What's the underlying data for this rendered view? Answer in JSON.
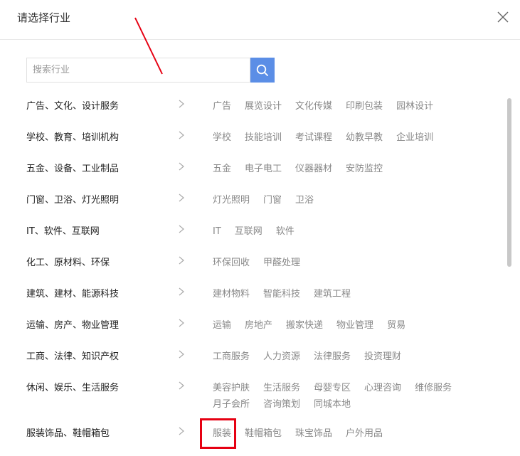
{
  "dialog": {
    "title": "请选择行业"
  },
  "search": {
    "placeholder": "搜索行业",
    "value": ""
  },
  "categories": [
    {
      "name": "广告、文化、设计服务",
      "tags": [
        "广告",
        "展览设计",
        "文化传媒",
        "印刷包装",
        "园林设计"
      ]
    },
    {
      "name": "学校、教育、培训机构",
      "tags": [
        "学校",
        "技能培训",
        "考试课程",
        "幼教早教",
        "企业培训"
      ]
    },
    {
      "name": "五金、设备、工业制品",
      "tags": [
        "五金",
        "电子电工",
        "仪器器材",
        "安防监控"
      ]
    },
    {
      "name": "门窗、卫浴、灯光照明",
      "tags": [
        "灯光照明",
        "门窗",
        "卫浴"
      ]
    },
    {
      "name": "IT、软件、互联网",
      "tags": [
        "IT",
        "互联网",
        "软件"
      ]
    },
    {
      "name": "化工、原材料、环保",
      "tags": [
        "环保回收",
        "甲醛处理"
      ]
    },
    {
      "name": "建筑、建材、能源科技",
      "tags": [
        "建材物料",
        "智能科技",
        "建筑工程"
      ]
    },
    {
      "name": "运输、房产、物业管理",
      "tags": [
        "运输",
        "房地产",
        "搬家快递",
        "物业管理",
        "贸易"
      ]
    },
    {
      "name": "工商、法律、知识产权",
      "tags": [
        "工商服务",
        "人力资源",
        "法律服务",
        "投资理财"
      ]
    },
    {
      "name": "休闲、娱乐、生活服务",
      "tags": [
        "美容护肤",
        "生活服务",
        "母婴专区",
        "心理咨询",
        "维修服务",
        "月子会所",
        "咨询策划",
        "同城本地"
      ]
    },
    {
      "name": "服装饰品、鞋帽箱包",
      "tags": [
        "服装",
        "鞋帽箱包",
        "珠宝饰品",
        "户外用品"
      ]
    }
  ],
  "colors": {
    "search_button": "#5b8ee6",
    "annotation": "#e60012",
    "tag_text": "#888888"
  },
  "icons": {
    "close": "close-icon",
    "search": "search-icon",
    "chevron": "chevron-right-icon"
  }
}
